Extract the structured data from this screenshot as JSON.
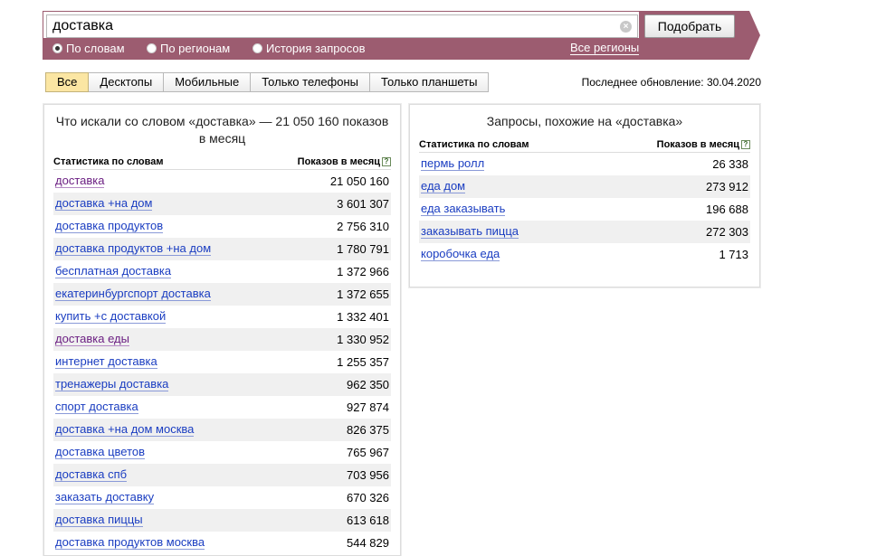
{
  "search": {
    "query": "доставка",
    "clear_symbol": "×",
    "button_label": "Подобрать",
    "modes": [
      {
        "label": "По словам",
        "checked": true
      },
      {
        "label": "По регионам",
        "checked": false
      },
      {
        "label": "История запросов",
        "checked": false
      }
    ],
    "regions_link": "Все регионы",
    "band_color": "#9c5c70"
  },
  "tabs": [
    {
      "label": "Все",
      "active": true
    },
    {
      "label": "Десктопы",
      "active": false
    },
    {
      "label": "Мобильные",
      "active": false
    },
    {
      "label": "Только телефоны",
      "active": false
    },
    {
      "label": "Только планшеты",
      "active": false
    }
  ],
  "last_update": "Последнее обновление: 30.04.2020",
  "left_panel": {
    "title": "Что искали со словом «доставка» — 21 050 160 показов в месяц",
    "col_words": "Статистика по словам",
    "col_shows": "Показов в месяц",
    "help_mark": "?",
    "rows": [
      {
        "phrase": "доставка",
        "count": "21 050 160",
        "visited": true
      },
      {
        "phrase": "доставка +на дом",
        "count": "3 601 307",
        "visited": false
      },
      {
        "phrase": "доставка продуктов",
        "count": "2 756 310",
        "visited": false
      },
      {
        "phrase": "доставка продуктов +на дом",
        "count": "1 780 791",
        "visited": false
      },
      {
        "phrase": "бесплатная доставка",
        "count": "1 372 966",
        "visited": false
      },
      {
        "phrase": "екатеринбургспорт доставка",
        "count": "1 372 655",
        "visited": false
      },
      {
        "phrase": "купить +с доставкой",
        "count": "1 332 401",
        "visited": false
      },
      {
        "phrase": "доставка еды",
        "count": "1 330 952",
        "visited": true
      },
      {
        "phrase": "интернет доставка",
        "count": "1 255 357",
        "visited": false
      },
      {
        "phrase": "тренажеры доставка",
        "count": "962 350",
        "visited": false
      },
      {
        "phrase": "спорт доставка",
        "count": "927 874",
        "visited": false
      },
      {
        "phrase": "доставка +на дом москва",
        "count": "826 375",
        "visited": false
      },
      {
        "phrase": "доставка цветов",
        "count": "765 967",
        "visited": false
      },
      {
        "phrase": "доставка спб",
        "count": "703 956",
        "visited": false
      },
      {
        "phrase": "заказать доставку",
        "count": "670 326",
        "visited": false
      },
      {
        "phrase": "доставка пиццы",
        "count": "613 618",
        "visited": false
      },
      {
        "phrase": "доставка продуктов москва",
        "count": "544 829",
        "visited": false
      }
    ]
  },
  "right_panel": {
    "title": "Запросы, похожие на «доставка»",
    "col_words": "Статистика по словам",
    "col_shows": "Показов в месяц",
    "help_mark": "?",
    "rows": [
      {
        "phrase": "пермь ролл",
        "count": "26 338",
        "visited": false
      },
      {
        "phrase": "еда дом",
        "count": "273 912",
        "visited": false
      },
      {
        "phrase": "еда заказывать",
        "count": "196 688",
        "visited": false
      },
      {
        "phrase": "заказывать пицца",
        "count": "272 303",
        "visited": false
      },
      {
        "phrase": "коробочка еда",
        "count": "1 713",
        "visited": false
      }
    ]
  }
}
